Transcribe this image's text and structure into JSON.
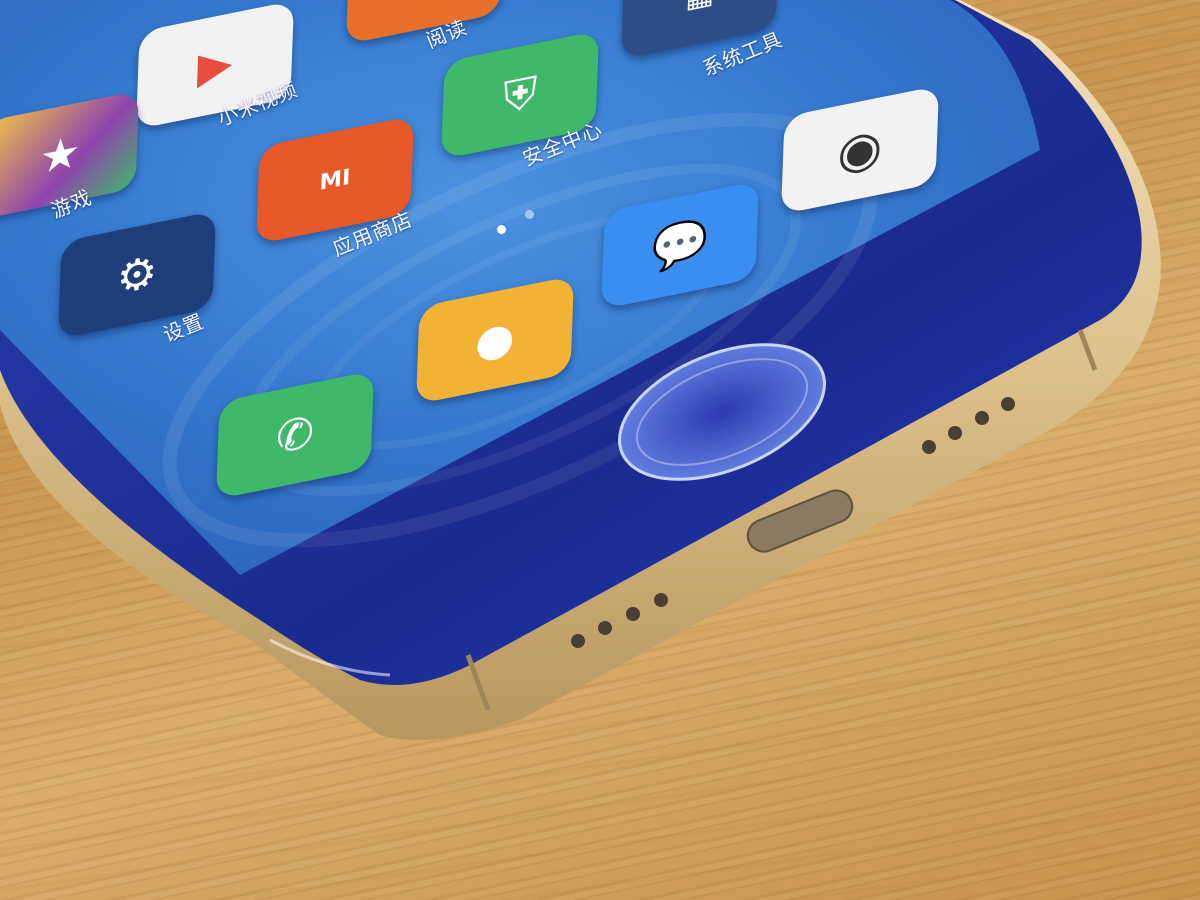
{
  "apps": {
    "video_label": "小米视频",
    "games_label": "游戏",
    "store_label": "应用商店",
    "store_logo": "MI",
    "settings_label": "设置",
    "security_label": "安全中心",
    "reading_label": "阅读",
    "tools_label": "系统工具",
    "phone_icon": "phone-icon",
    "messages_icon": "message-icon",
    "chat_icon": "chat-icon",
    "camera_icon": "camera-icon"
  },
  "colors": {
    "screen": "#2f73c9",
    "bezel": "#1b2f9a",
    "frame": "#e9cf9b",
    "wood": "#cf9f58"
  },
  "home_screen_page_dots": {
    "total": 2,
    "active": 1
  }
}
